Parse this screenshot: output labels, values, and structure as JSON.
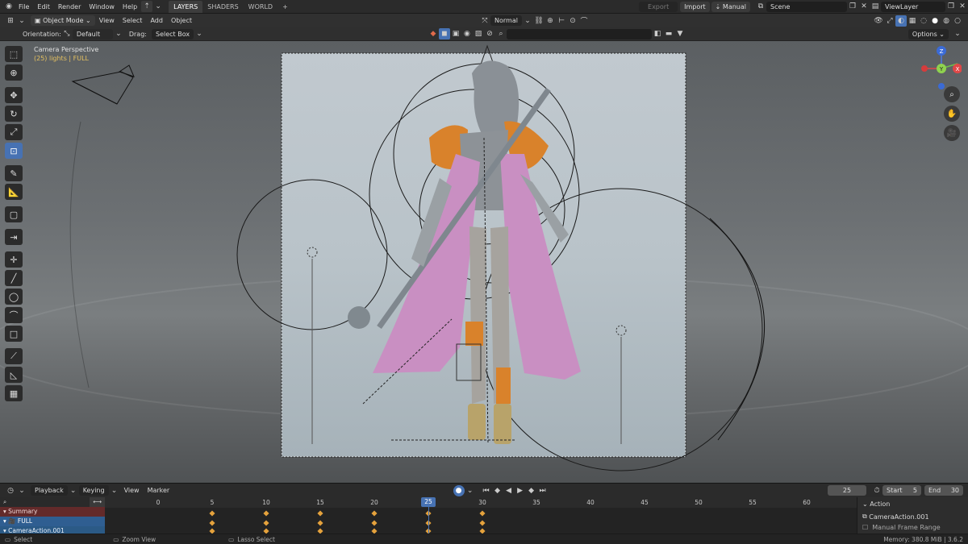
{
  "topbar": {
    "menus": [
      "File",
      "Edit",
      "Render",
      "Window",
      "Help"
    ],
    "tabs": [
      "LAYERS",
      "SHADERS",
      "WORLD"
    ],
    "add_tab": "+",
    "export_label": "Export",
    "import_label": "Import",
    "manual_label": "Manual",
    "scene": "Scene",
    "view_layer": "ViewLayer"
  },
  "header": {
    "mode": "Object Mode",
    "menus": [
      "View",
      "Select",
      "Add",
      "Object"
    ],
    "transform": "Normal"
  },
  "tool_settings": {
    "orientation_label": "Orientation:",
    "orientation_value": "Default",
    "drag_label": "Drag:",
    "drag_value": "Select Box",
    "options_label": "Options"
  },
  "viewport": {
    "title": "Camera Perspective",
    "subtitle": "(25) lights | FULL",
    "gizmo": {
      "z": "Z",
      "y": "Y",
      "x": "X"
    }
  },
  "timeline": {
    "menus": [
      "Playback",
      "Keying",
      "View",
      "Marker"
    ],
    "current_frame": "25",
    "start_label": "Start",
    "start_value": "5",
    "end_label": "End",
    "end_value": "30",
    "ticks": [
      "0",
      "5",
      "10",
      "15",
      "20",
      "25",
      "30",
      "35",
      "40",
      "45",
      "50",
      "55",
      "60"
    ],
    "channels": [
      "Summary",
      "FULL",
      "CameraAction.001"
    ],
    "action_title": "Action",
    "action_name": "CameraAction.001",
    "manual_frame_range": "Manual Frame Range"
  },
  "statusbar": {
    "select": "Select",
    "zoom_view": "Zoom View",
    "lasso_select": "Lasso Select",
    "memory": "Memory: 380.8 MiB | 3.6.2"
  },
  "colors": {
    "accent": "#4772b3",
    "keyframe": "#e5a23c",
    "summary": "#632a2a",
    "orange_armor": "#e08a2a",
    "cape_pink": "#c88fbf"
  }
}
